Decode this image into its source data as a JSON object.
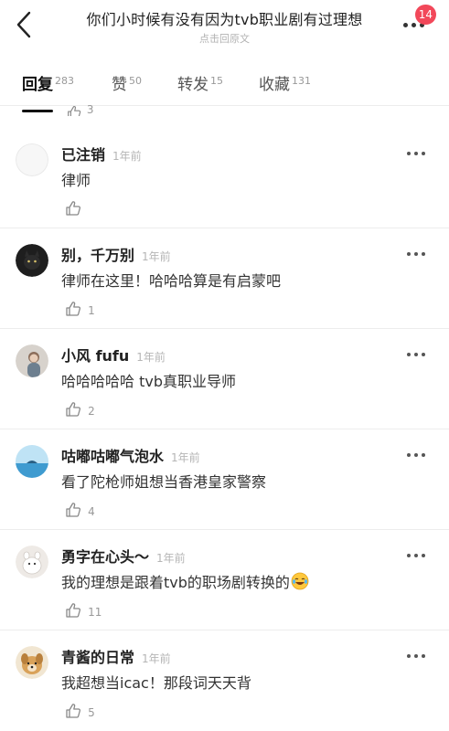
{
  "header": {
    "title": "你们小时候有没有因为tvb职业剧有过理想",
    "subtitle": "点击回原文",
    "badge_count": "14"
  },
  "tabs": [
    {
      "label": "回复",
      "count": "283"
    },
    {
      "label": "赞",
      "count": "50"
    },
    {
      "label": "转发",
      "count": "15"
    },
    {
      "label": "收藏",
      "count": "131"
    }
  ],
  "partial_like_count": "3",
  "comments": [
    {
      "username": "已注销",
      "time": "1年前",
      "text": "律师",
      "likes": "",
      "avatar_icon": "blank-avatar"
    },
    {
      "username": "别，千万别",
      "time": "1年前",
      "text": "律师在这里！哈哈哈算是有启蒙吧",
      "likes": "1",
      "avatar_icon": "cat-avatar"
    },
    {
      "username": "小风 fufu",
      "time": "1年前",
      "text": "哈哈哈哈哈 tvb真职业导师",
      "likes": "2",
      "avatar_icon": "girl-avatar"
    },
    {
      "username": "咕嘟咕嘟气泡水",
      "time": "1年前",
      "text": "看了陀枪师姐想当香港皇家警察",
      "likes": "4",
      "avatar_icon": "sea-avatar"
    },
    {
      "username": "勇字在心头～",
      "time": "1年前",
      "text": "我的理想是跟着tvb的职场剧转换的",
      "likes": "11",
      "avatar_icon": "moomin-avatar"
    },
    {
      "username": "青酱的日常",
      "time": "1年前",
      "text": "我超想当icac！那段词天天背",
      "likes": "5",
      "avatar_icon": "dog-avatar"
    }
  ],
  "colors": {
    "badge": "#f2485a",
    "active_tab": "#111111",
    "muted": "#999999"
  }
}
